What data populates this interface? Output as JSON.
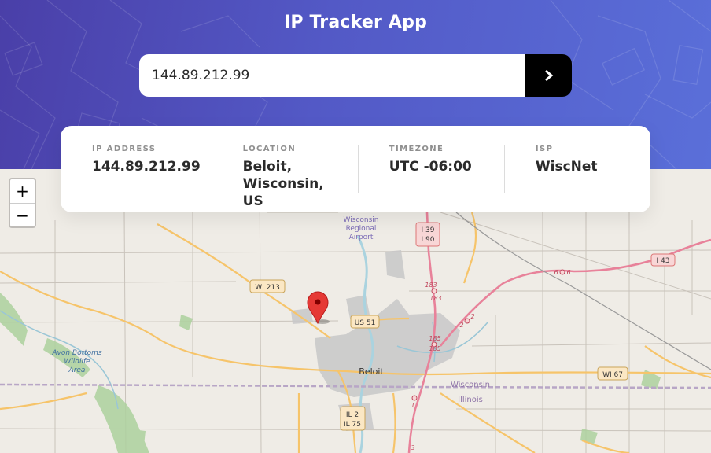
{
  "app": {
    "title": "IP Tracker App"
  },
  "search": {
    "value": "144.89.212.99",
    "submit_icon": "chevron-right-icon"
  },
  "info": {
    "ip_label": "IP ADDRESS",
    "ip_value": "144.89.212.99",
    "location_label": "LOCATION",
    "location_line1": "Beloit,",
    "location_line2": "Wisconsin, US",
    "timezone_label": "TIMEZONE",
    "timezone_value": "UTC -06:00",
    "isp_label": "ISP",
    "isp_value": "WiscNet"
  },
  "map": {
    "zoom_in": "+",
    "zoom_out": "−",
    "labels": {
      "airport1": "Wisconsin",
      "airport2": "Regional",
      "airport3": "Airport",
      "shield_i39": "I 39",
      "shield_i90": "I 90",
      "shield_i43": "I 43",
      "shield_wi213": "WI 213",
      "shield_us51": "US 51",
      "shield_wi67": "WI 67",
      "shield_il2": "IL 2",
      "shield_il75": "IL 75",
      "avon1": "Avon Bottoms",
      "avon2": "Wildlife",
      "avon3": "Area",
      "city": "Beloit",
      "state_wi": "Wisconsin",
      "state_il": "Illinois",
      "exit183a": "183",
      "exit183b": "183",
      "exit185a": "185",
      "exit185b": "185",
      "exit2a": "2",
      "exit2b": "2",
      "exit6a": "6",
      "exit6b": "6",
      "exit1": "1",
      "exit3": "3"
    },
    "marker_icon": "map-pin-icon",
    "colors": {
      "motorway": "#e8829a",
      "primary": "#f6c46a",
      "water": "#aad3df",
      "urban": "#c8c8c8",
      "forest": "#add19e",
      "boundary": "#b8a6c6"
    }
  },
  "colors": {
    "header_start": "#4a3fa8",
    "header_end": "#5a6fd9",
    "button": "#000000",
    "text_dark": "#2b2b2b",
    "text_label": "#8f8f8f"
  }
}
